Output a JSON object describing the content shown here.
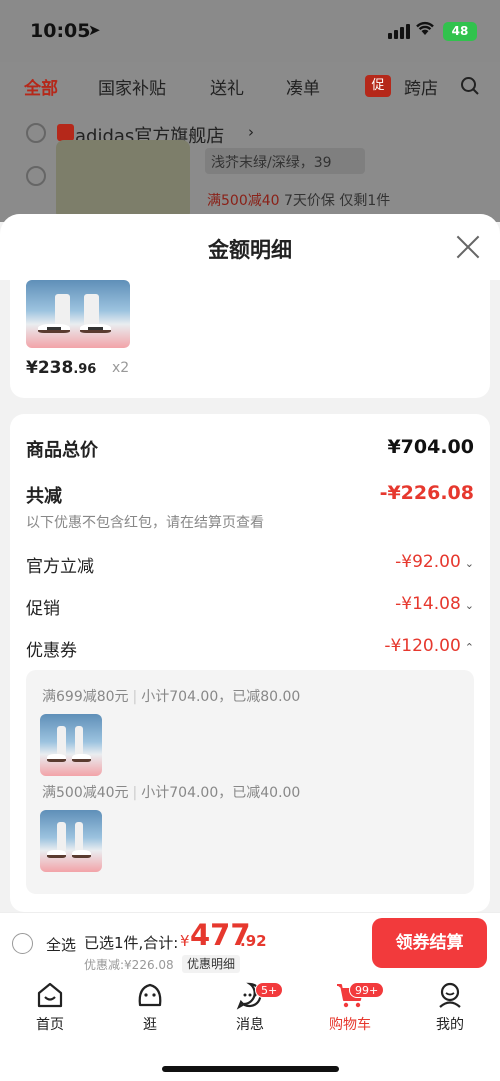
{
  "status_bar": {
    "time": "10:05",
    "battery": "48"
  },
  "bg_page": {
    "tabs": [
      {
        "label": "全部",
        "active": true
      },
      {
        "label": "国家补贴"
      },
      {
        "label": "送礼"
      },
      {
        "label": "凑单"
      },
      {
        "label": "跨店"
      }
    ],
    "tab_badge": "促",
    "shop_name": "adidas官方旗舰店",
    "variant": "浅芥末绿/深绿，39",
    "promo": "满500减40",
    "promo_rest": "7天价保  仅剩1件"
  },
  "sheet": {
    "title": "金额明细",
    "item": {
      "price_int": "¥238",
      "price_dec": ".96",
      "qty": "x2"
    },
    "rows": {
      "goods_total_label": "商品总价",
      "goods_total_value": "¥704.00",
      "total_off_label": "共减",
      "total_off_value": "-¥226.08",
      "note": "以下优惠不包含红包，请在结算页查看",
      "official_label": "官方立减",
      "official_value": "-¥92.00",
      "promo_label": "促销",
      "promo_value": "-¥14.08",
      "coupon_label": "优惠券",
      "coupon_value": "-¥120.00"
    },
    "coupons": [
      {
        "rule": "满699减80元",
        "detail": "小计704.00，已减80.00"
      },
      {
        "rule": "满500减40元",
        "detail": "小计704.00，已减40.00"
      }
    ]
  },
  "checkout": {
    "select_all": "全选",
    "selected_text": "已选1件,合计:",
    "currency": "¥",
    "total_int": "477",
    "total_dec": ".92",
    "discount": "优惠减:¥226.08",
    "detail_btn": "优惠明细",
    "pay_btn": "领券结算"
  },
  "tabbar": {
    "items": [
      {
        "label": "首页"
      },
      {
        "label": "逛"
      },
      {
        "label": "消息",
        "badge": "5+"
      },
      {
        "label": "购物车",
        "badge": "99+",
        "active": true
      },
      {
        "label": "我的"
      }
    ]
  },
  "colors": {
    "accent": "#f23a3c",
    "price_red": "#e6382e"
  }
}
